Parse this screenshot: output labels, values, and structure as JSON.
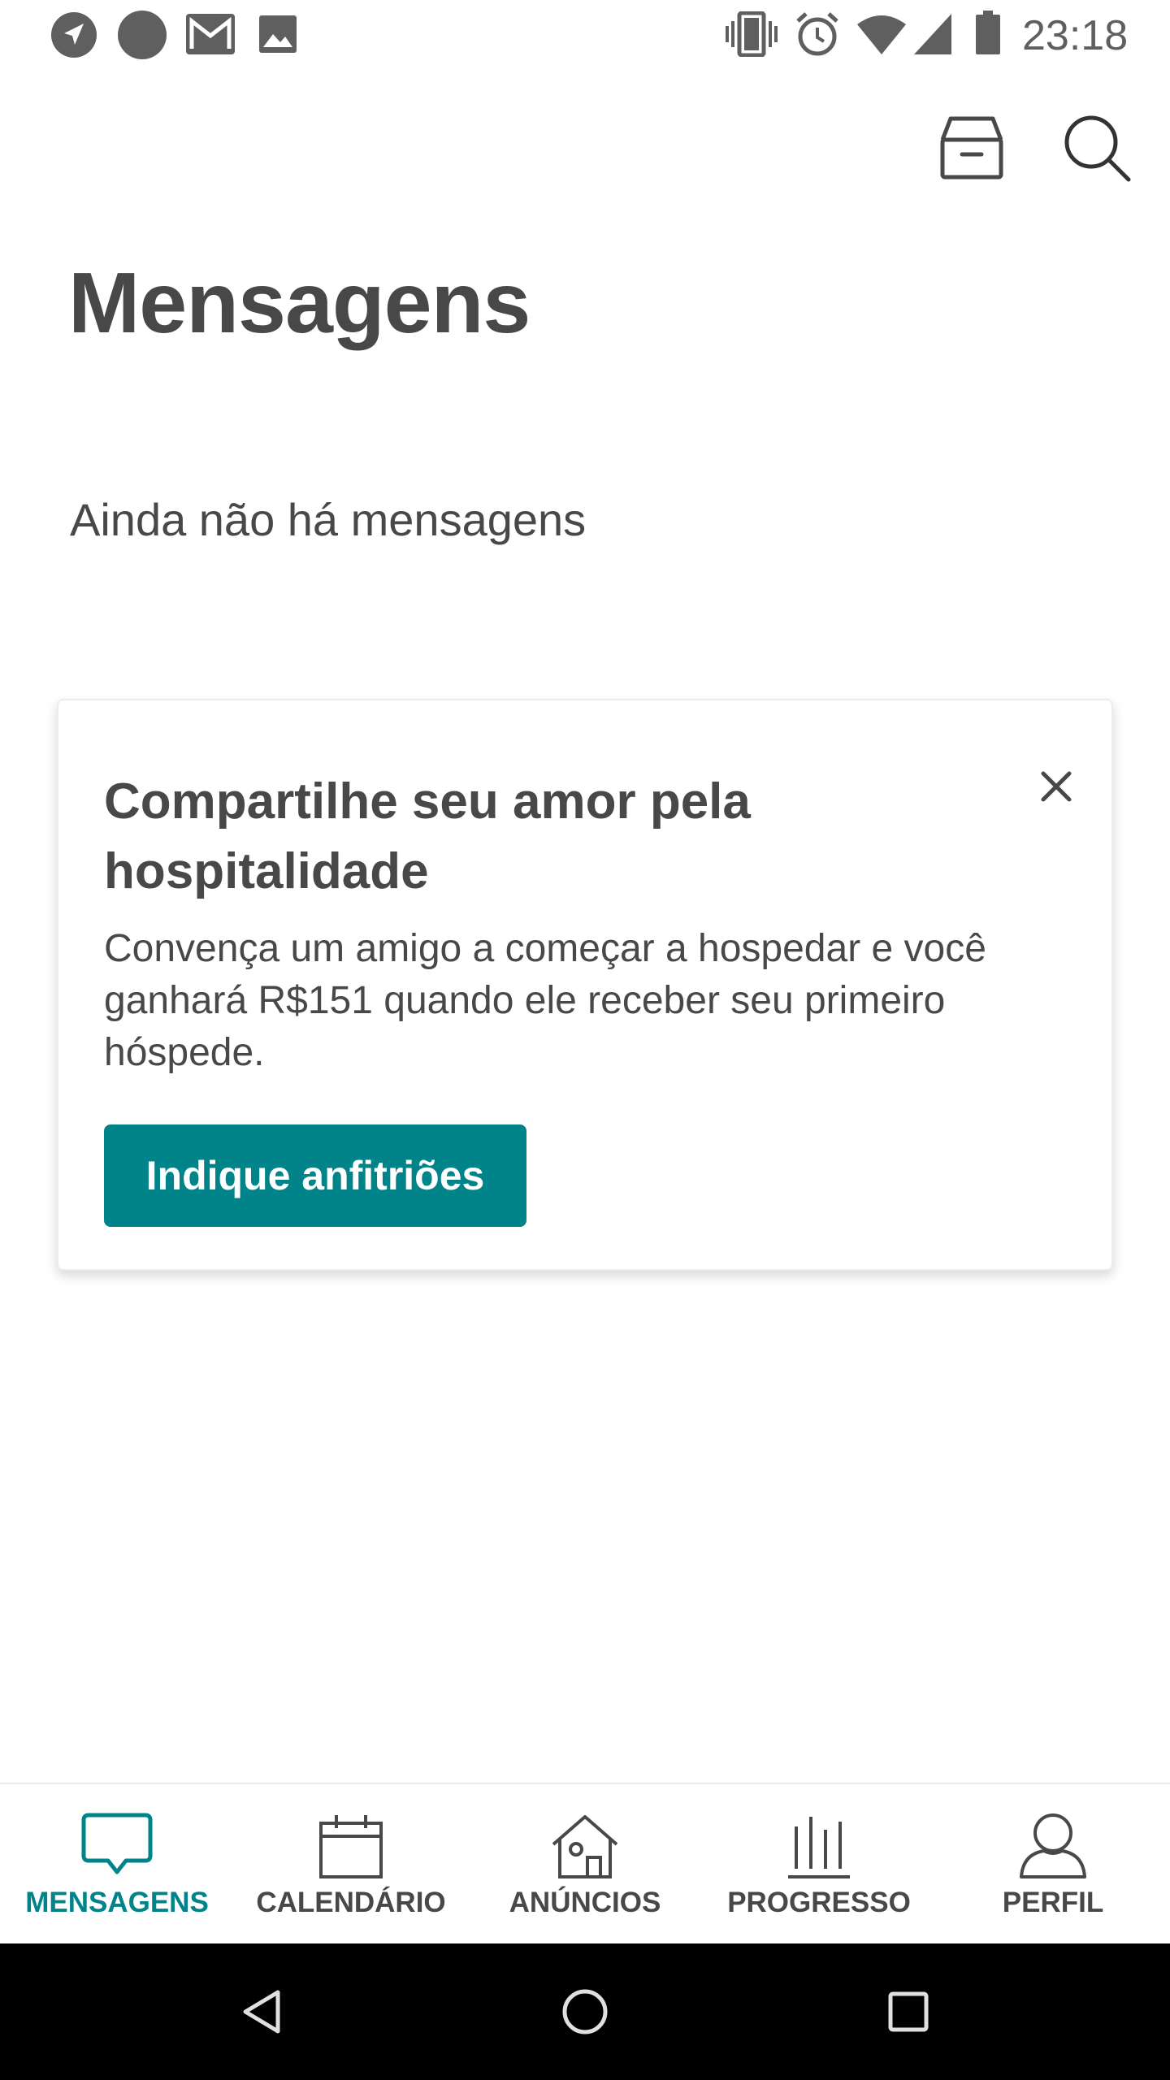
{
  "status_bar": {
    "time": "23:18",
    "left_icons": [
      "navigation-icon",
      "dot-icon",
      "gmail-icon",
      "image-icon"
    ],
    "right_icons": [
      "vibrate-icon",
      "alarm-icon",
      "wifi-icon",
      "signal-icon",
      "battery-icon"
    ]
  },
  "header": {
    "actions": [
      "archive-icon",
      "search-icon"
    ]
  },
  "page": {
    "title": "Mensagens",
    "empty_state": "Ainda não há mensagens"
  },
  "referral_card": {
    "title": "Compartilhe seu amor pela hospitalidade",
    "body": "Convença um amigo a começar a hospedar e você ganhará R$151 quando ele receber seu primeiro hóspede.",
    "button_label": "Indique anfitriões",
    "close_icon": "close-icon"
  },
  "tabs": [
    {
      "label": "MENSAGENS",
      "icon": "chat-bubble-icon",
      "active": true
    },
    {
      "label": "CALENDÁRIO",
      "icon": "calendar-icon",
      "active": false
    },
    {
      "label": "ANÚNCIOS",
      "icon": "house-icon",
      "active": false
    },
    {
      "label": "PROGRESSO",
      "icon": "bar-chart-icon",
      "active": false
    },
    {
      "label": "PERFIL",
      "icon": "person-icon",
      "active": false
    }
  ],
  "system_nav": [
    "back-icon",
    "home-icon",
    "recents-icon"
  ],
  "colors": {
    "accent": "#008489",
    "text": "#484848",
    "background": "#ffffff",
    "nav_bar": "#000000"
  }
}
